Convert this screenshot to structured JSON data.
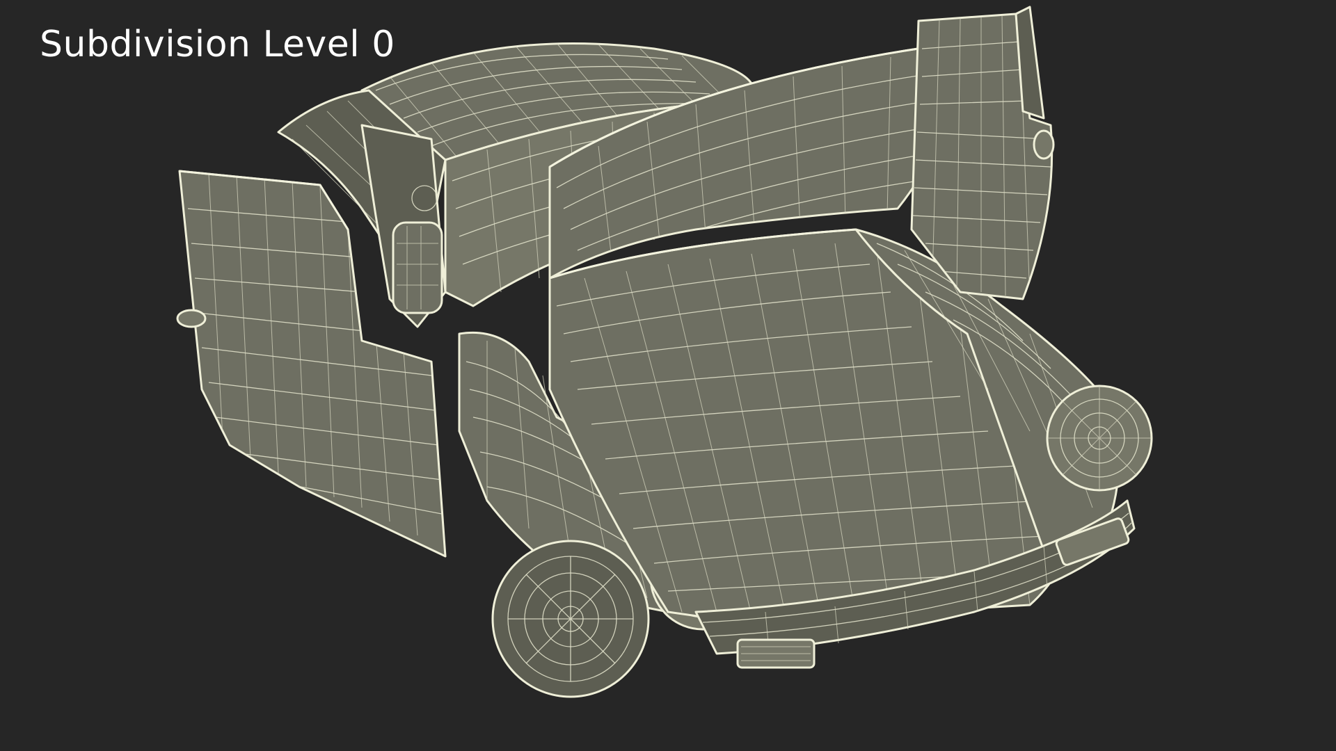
{
  "caption": {
    "text": "Subdivision Level 0"
  },
  "colors": {
    "background": "#262626",
    "mesh_fill": "#6e6f62",
    "wire": "#e6e6cf",
    "caption_text": "#ffffff"
  }
}
